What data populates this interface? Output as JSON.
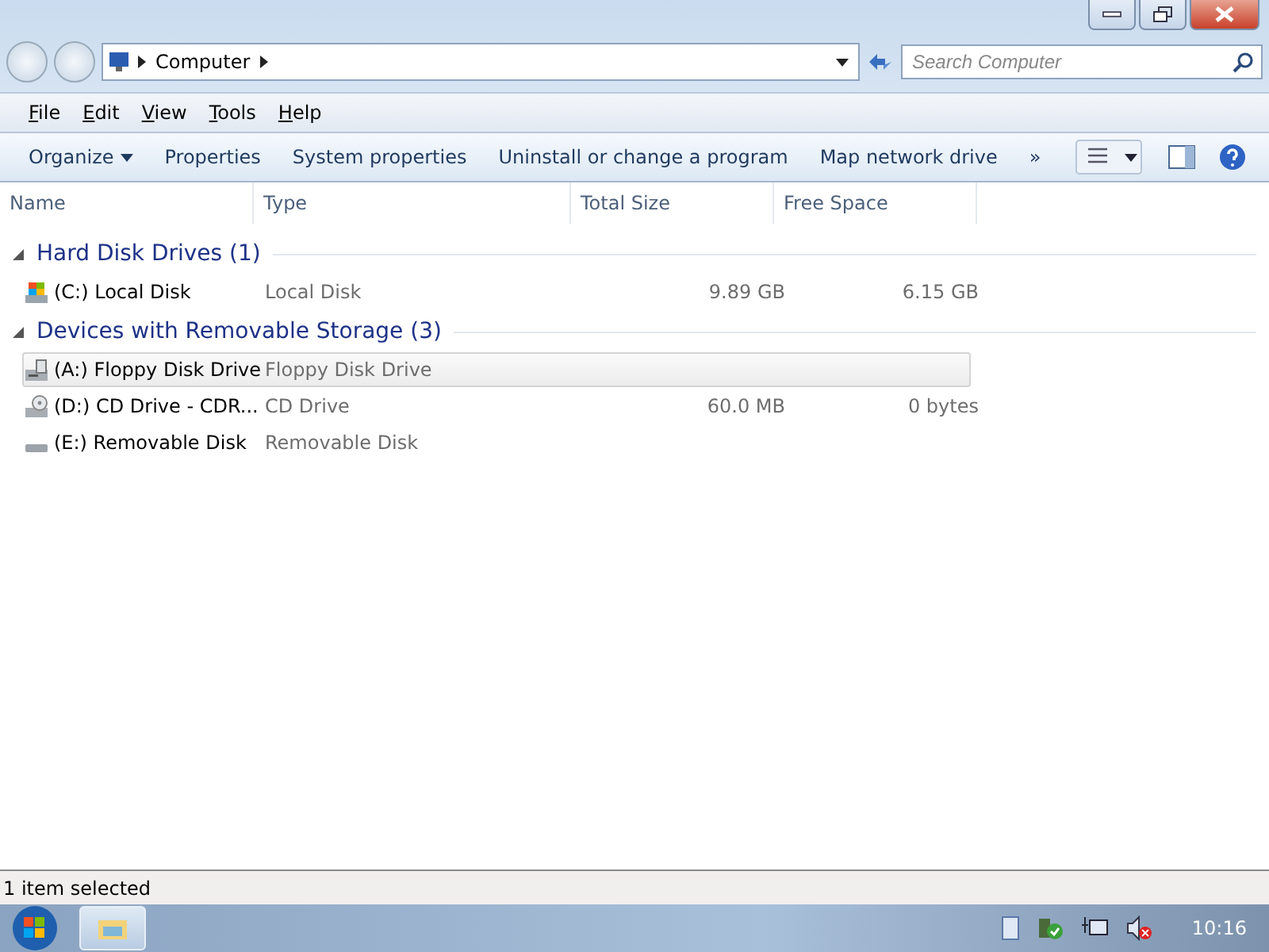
{
  "address": {
    "crumbs": [
      "Computer"
    ]
  },
  "search": {
    "placeholder": "Search Computer"
  },
  "menu": [
    "File",
    "Edit",
    "View",
    "Tools",
    "Help"
  ],
  "toolbar": {
    "organize": "Organize",
    "buttons": [
      "Properties",
      "System properties",
      "Uninstall or change a program",
      "Map network drive"
    ],
    "more": "»"
  },
  "columns": [
    "Name",
    "Type",
    "Total Size",
    "Free Space"
  ],
  "groups": [
    {
      "title": "Hard Disk Drives (1)",
      "expanded": true,
      "items": [
        {
          "kind": "hdd",
          "name": "(C:) Local Disk",
          "type": "Local Disk",
          "total": "9.89 GB",
          "free": "6.15 GB",
          "selected": false
        }
      ]
    },
    {
      "title": "Devices with Removable Storage (3)",
      "expanded": true,
      "items": [
        {
          "kind": "floppy",
          "name": "(A:) Floppy Disk Drive",
          "type": "Floppy Disk Drive",
          "selected": true
        },
        {
          "kind": "cd",
          "name": "(D:) CD Drive - CDR...",
          "type": "CD Drive",
          "total": "60.0 MB",
          "free": "0 bytes",
          "selected": false
        },
        {
          "kind": "removable",
          "name": "(E:) Removable Disk",
          "type": "Removable Disk",
          "selected": false
        }
      ]
    }
  ],
  "status_bar": "1 item selected",
  "clock": "10:16"
}
